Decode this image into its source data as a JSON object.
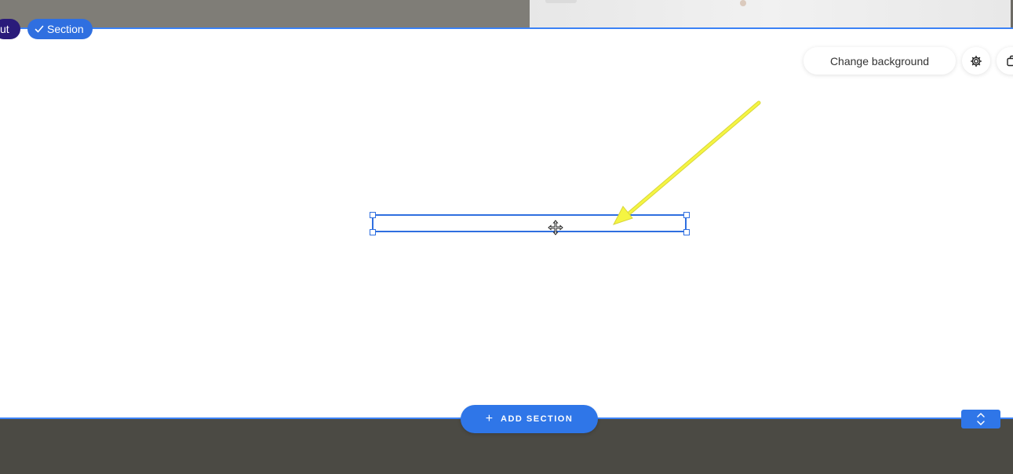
{
  "breadcrumb": {
    "layout_label": "ut",
    "section_label": "Section"
  },
  "section_actions": {
    "change_background_label": "Change background",
    "settings_icon": "gear-icon",
    "duplicate_icon": "duplicate-icon"
  },
  "selection": {
    "move_icon": "move-icon"
  },
  "add_section": {
    "plus": "+",
    "label": "ADD SECTION"
  },
  "scroll_toggle_icon": "chevron-up-down-icon",
  "colors": {
    "accent": "#2f76e8",
    "layout_pill": "#2a1b7a",
    "footer": "#4b4a44",
    "annotation_arrow": "#f5f542"
  }
}
